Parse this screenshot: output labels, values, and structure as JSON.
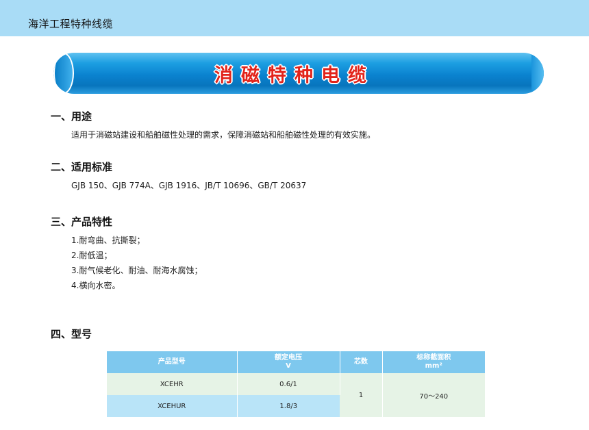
{
  "header": {
    "title": "海洋工程特种线缆"
  },
  "banner": {
    "title": "消磁特种电缆"
  },
  "sections": {
    "usage": {
      "heading": "一、用途",
      "text": "适用于消磁站建设和船舶磁性处理的需求，保障消磁站和船舶磁性处理的有效实施。"
    },
    "standards": {
      "heading": "二、适用标准",
      "text": "GJB 150、GJB 774A、GJB 1916、JB/T 10696、GB/T 20637"
    },
    "features": {
      "heading": "三、产品特性",
      "items": [
        "1.耐弯曲、抗撕裂；",
        "2.耐低温；",
        "3.耐气候老化、耐油、耐海水腐蚀；",
        "4.横向水密。"
      ]
    },
    "models": {
      "heading": "四、型号"
    }
  },
  "table": {
    "headers": {
      "model": "产品型号",
      "voltage": "额定电压",
      "voltage_unit": "V",
      "cores": "芯数",
      "section": "标称截面积",
      "section_unit": "mm²"
    },
    "rows": [
      {
        "model": "XCEHR",
        "voltage": "0.6/1"
      },
      {
        "model": "XCEHUR",
        "voltage": "1.8/3"
      }
    ],
    "cores": "1",
    "section": "70～240"
  },
  "colors": {
    "topbar": "#a9dcf6",
    "banner_blue": "#0a82cf",
    "banner_text": "#e2231a",
    "table_header": "#7ec8ee"
  }
}
